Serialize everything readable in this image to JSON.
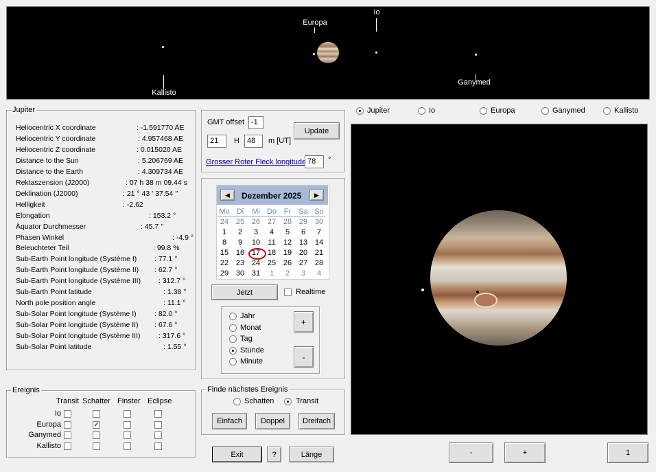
{
  "top_view": {
    "moons": [
      {
        "name": "Europa",
        "label": "Europa"
      },
      {
        "name": "Io",
        "label": "Io"
      },
      {
        "name": "Kallisto",
        "label": "Kallisto"
      },
      {
        "name": "Ganymed",
        "label": "Ganymed"
      }
    ]
  },
  "jupiter_panel": {
    "title": "Jupiter",
    "rows": [
      {
        "label": "Heliocentric X coordinate",
        "value": ": -1.591770 AE"
      },
      {
        "label": "Heliocentric Y coordinate",
        "value": ": 4.957468 AE"
      },
      {
        "label": "Heliocentric Z coordinate",
        "value": ": 0.015020 AE"
      },
      {
        "label": "Distance to the Sun",
        "value": ": 5.206769 AE"
      },
      {
        "label": "Distance to the Earth",
        "value": ": 4.309734 AE"
      },
      {
        "label": "Rektaszension (J2000)",
        "value": ":  07 h 38 m 09.44 s"
      },
      {
        "label": "Deklination (J2000)",
        "value": ":  21 ° 43 ' 37.54 ''"
      },
      {
        "label": "Helligkeit",
        "value": ": -2.62"
      },
      {
        "label": "Elongation",
        "value": ": 153.2 °"
      },
      {
        "label": "Äquator Durchmesser",
        "value": ": 45.7 ''"
      },
      {
        "label": "Phasen Winkel",
        "value": ":  -4.9 °"
      },
      {
        "label": "Beleuchteter Teil",
        "value": ": 99.8 %"
      },
      {
        "label": "Sub-Earth Point longitude (Système I)",
        "value": ":  77.1 °"
      },
      {
        "label": "Sub-Earth Point longitude (Système II)",
        "value": ":  62.7 °"
      },
      {
        "label": "Sub-Earth Point longitude (Système III)",
        "value": ": 312.7 °"
      },
      {
        "label": "Sub-Earth Point latitude",
        "value": ":  1.38 °"
      },
      {
        "label": "North pole position angle",
        "value": ":  11.1 °"
      },
      {
        "label": "Sub-Solar Point longitude (Système I)",
        "value": ":  82.0 °"
      },
      {
        "label": "Sub-Solar Point longitude (Système II)",
        "value": ":  67.6 °"
      },
      {
        "label": "Sub-Solar Point longitude (Système III)",
        "value": ": 317.6 °"
      },
      {
        "label": "Sub-Solar Point latitude",
        "value": ":  1.55 °"
      }
    ]
  },
  "gmt": {
    "offset_label": "GMT offset",
    "offset_value": "-1",
    "hour_value": "21",
    "h_label": "H",
    "minute_value": "48",
    "m_label": "m [UT]",
    "update_label": "Update",
    "grf_link": "Grosser Roter Fleck longitude",
    "grf_value": "78",
    "grf_unit": "°"
  },
  "calendar": {
    "month_label": "Dezember 2025",
    "prev": "◀",
    "next": "▶",
    "weekdays": [
      "Mo",
      "Di",
      "Mi",
      "Do",
      "Fr",
      "Sa",
      "So"
    ],
    "weeks": [
      [
        "24",
        "25",
        "26",
        "27",
        "28",
        "29",
        "30"
      ],
      [
        "1",
        "2",
        "3",
        "4",
        "5",
        "6",
        "7"
      ],
      [
        "8",
        "9",
        "10",
        "11",
        "12",
        "13",
        "14"
      ],
      [
        "15",
        "16",
        "17",
        "18",
        "19",
        "20",
        "21"
      ],
      [
        "22",
        "23",
        "24",
        "25",
        "26",
        "27",
        "28"
      ],
      [
        "29",
        "30",
        "31",
        "1",
        "2",
        "3",
        "4"
      ]
    ],
    "today": "17",
    "jetzt_label": "Jetzt",
    "realtime_label": "Realtime"
  },
  "step": {
    "options": [
      "Jahr",
      "Monat",
      "Tag",
      "Stunde",
      "Minute"
    ],
    "selected": "Stunde",
    "plus": "+",
    "minus": "-"
  },
  "moon_select": {
    "options": [
      "Jupiter",
      "Io",
      "Europa",
      "Ganymed",
      "Kallisto"
    ],
    "selected": "Jupiter"
  },
  "ereignis": {
    "title": "Ereignis",
    "columns": [
      "Transit",
      "Schatter",
      "Finster",
      "Eclipse"
    ],
    "rows": [
      {
        "name": "Io",
        "checks": [
          false,
          false,
          false,
          false
        ]
      },
      {
        "name": "Europa",
        "checks": [
          false,
          true,
          false,
          false
        ]
      },
      {
        "name": "Ganymed",
        "checks": [
          false,
          false,
          false,
          false
        ]
      },
      {
        "name": "Kallisto",
        "checks": [
          false,
          false,
          false,
          false
        ]
      }
    ]
  },
  "finde": {
    "title": "Finde nächstes Ereignis",
    "schatten_label": "Schatten",
    "transit_label": "Transit",
    "selected": "Transit",
    "einfach": "Einfach",
    "doppel": "Doppel",
    "dreifach": "Dreifach"
  },
  "bottom": {
    "exit": "Exit",
    "help": "?",
    "laenge": "Länge",
    "zoom_minus": "-",
    "zoom_plus": "+",
    "zoom_value": "1"
  },
  "colors": {
    "space": "#000000",
    "link": "#0000c0",
    "calendar_header": "#a6b9d6",
    "today_circle": "#c00000"
  }
}
